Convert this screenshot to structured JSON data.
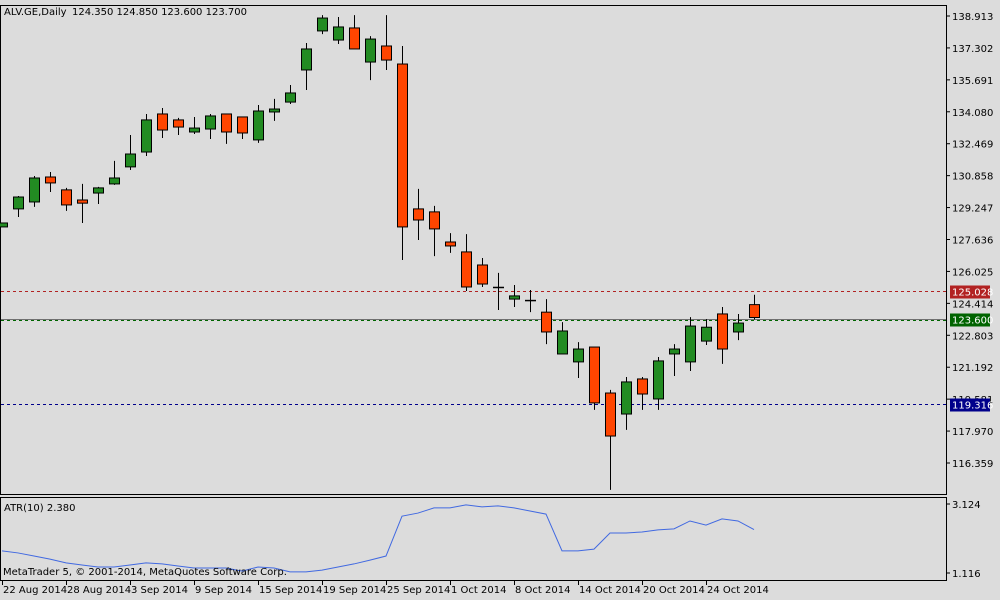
{
  "header": {
    "symbol": "ALV.GE,Daily",
    "ohlc": "124.350 124.850 123.600 123.700"
  },
  "indicator": {
    "label": "ATR(10) 2.380",
    "axis_labels": [
      "3.124",
      "1.116"
    ],
    "axis_values": [
      3.124,
      1.116
    ]
  },
  "copyright": "MetaTrader 5, © 2001-2014, MetaQuotes Software Corp.",
  "colors": {
    "bull": "#228b22",
    "bear": "#ff4500",
    "background": "#dcdcdc",
    "atr": "#4169e1"
  },
  "chart_data": {
    "type": "candlestick",
    "title": "ALV.GE,Daily",
    "price_ticks": [
      "138.913",
      "137.302",
      "135.691",
      "134.080",
      "132.469",
      "130.858",
      "129.247",
      "127.636",
      "126.025",
      "124.414",
      "122.803",
      "121.192",
      "119.581",
      "117.970",
      "116.359"
    ],
    "price_ylim": [
      116.359,
      138.913
    ],
    "levels": [
      {
        "label": "125.028",
        "value": 125.028,
        "color": "#b22222",
        "style": "dashed"
      },
      {
        "label": "123.600",
        "value": 123.6,
        "color": "#006400",
        "style": "solid"
      },
      {
        "label": "119.316",
        "value": 119.316,
        "color": "#00008b",
        "style": "dashed"
      }
    ],
    "date_labels": [
      {
        "label": "22 Aug 2014",
        "index": 0
      },
      {
        "label": "28 Aug 2014",
        "index": 4
      },
      {
        "label": "3 Sep 2014",
        "index": 8
      },
      {
        "label": "9 Sep 2014",
        "index": 12
      },
      {
        "label": "15 Sep 2014",
        "index": 16
      },
      {
        "label": "19 Sep 2014",
        "index": 20
      },
      {
        "label": "25 Sep 2014",
        "index": 24
      },
      {
        "label": "1 Oct 2014",
        "index": 28
      },
      {
        "label": "8 Oct 2014",
        "index": 32
      },
      {
        "label": "14 Oct 2014",
        "index": 36
      },
      {
        "label": "20 Oct 2014",
        "index": 40
      },
      {
        "label": "24 Oct 2014",
        "index": 44
      }
    ],
    "ohlc": [
      [
        128.27,
        128.47,
        128.27,
        128.47
      ],
      [
        129.18,
        129.83,
        128.77,
        129.78
      ],
      [
        129.53,
        130.84,
        129.28,
        130.74
      ],
      [
        130.79,
        131.04,
        130.03,
        130.49
      ],
      [
        130.14,
        130.24,
        129.08,
        129.38
      ],
      [
        129.63,
        130.44,
        128.47,
        129.47
      ],
      [
        129.98,
        130.29,
        129.43,
        130.24
      ],
      [
        130.44,
        131.6,
        130.39,
        130.74
      ],
      [
        131.3,
        132.91,
        131.14,
        131.95
      ],
      [
        132.05,
        133.97,
        131.85,
        133.67
      ],
      [
        133.97,
        134.27,
        132.76,
        133.16
      ],
      [
        133.67,
        133.77,
        132.91,
        133.31
      ],
      [
        133.06,
        133.82,
        132.96,
        133.26
      ],
      [
        133.21,
        133.97,
        132.71,
        133.87
      ],
      [
        133.97,
        133.97,
        132.46,
        133.06
      ],
      [
        133.82,
        133.82,
        132.71,
        133.01
      ],
      [
        132.66,
        134.42,
        132.51,
        134.12
      ],
      [
        134.07,
        134.73,
        133.62,
        134.22
      ],
      [
        134.57,
        135.43,
        134.47,
        135.03
      ],
      [
        136.19,
        137.55,
        135.18,
        137.25
      ],
      [
        138.16,
        138.96,
        138.0,
        138.81
      ],
      [
        137.7,
        138.86,
        137.5,
        138.36
      ],
      [
        138.31,
        138.96,
        137.25,
        137.25
      ],
      [
        136.59,
        137.9,
        135.68,
        137.75
      ],
      [
        137.4,
        138.96,
        136.19,
        136.69
      ],
      [
        136.49,
        137.4,
        126.6,
        128.27
      ],
      [
        129.18,
        130.19,
        127.61,
        128.62
      ],
      [
        129.03,
        129.33,
        126.8,
        128.17
      ],
      [
        127.51,
        127.96,
        126.96,
        127.31
      ],
      [
        127.01,
        127.91,
        125.04,
        125.24
      ],
      [
        126.35,
        126.7,
        125.24,
        125.39
      ],
      [
        125.24,
        125.95,
        124.08,
        125.24
      ],
      [
        124.63,
        125.34,
        124.23,
        124.79
      ],
      [
        124.58,
        125.09,
        123.97,
        124.58
      ],
      [
        123.97,
        124.63,
        122.36,
        122.97
      ],
      [
        121.86,
        123.47,
        121.86,
        123.02
      ],
      [
        121.46,
        122.46,
        120.65,
        122.11
      ],
      [
        122.21,
        122.21,
        119.04,
        119.39
      ],
      [
        119.89,
        120.05,
        115.0,
        117.72
      ],
      [
        118.83,
        120.7,
        118.03,
        120.45
      ],
      [
        120.6,
        120.7,
        119.04,
        119.84
      ],
      [
        119.59,
        121.71,
        119.04,
        121.51
      ],
      [
        121.86,
        122.36,
        120.75,
        122.11
      ],
      [
        121.46,
        123.72,
        121.0,
        123.27
      ],
      [
        122.51,
        123.62,
        122.31,
        123.21
      ],
      [
        123.88,
        124.23,
        121.36,
        122.11
      ],
      [
        122.97,
        123.88,
        122.56,
        123.42
      ],
      [
        124.35,
        124.85,
        123.6,
        123.7
      ]
    ],
    "atr": [
      1.76,
      1.7,
      1.61,
      1.52,
      1.41,
      1.35,
      1.29,
      1.29,
      1.35,
      1.41,
      1.38,
      1.32,
      1.26,
      1.26,
      1.26,
      1.17,
      1.29,
      1.26,
      1.15,
      1.15,
      1.2,
      1.29,
      1.38,
      1.49,
      1.61,
      2.77,
      2.86,
      3.01,
      3.01,
      3.1,
      3.04,
      3.07,
      3.01,
      2.92,
      2.83,
      1.76,
      1.76,
      1.81,
      2.28,
      2.28,
      2.31,
      2.37,
      2.4,
      2.63,
      2.51,
      2.69,
      2.63,
      2.38
    ]
  }
}
